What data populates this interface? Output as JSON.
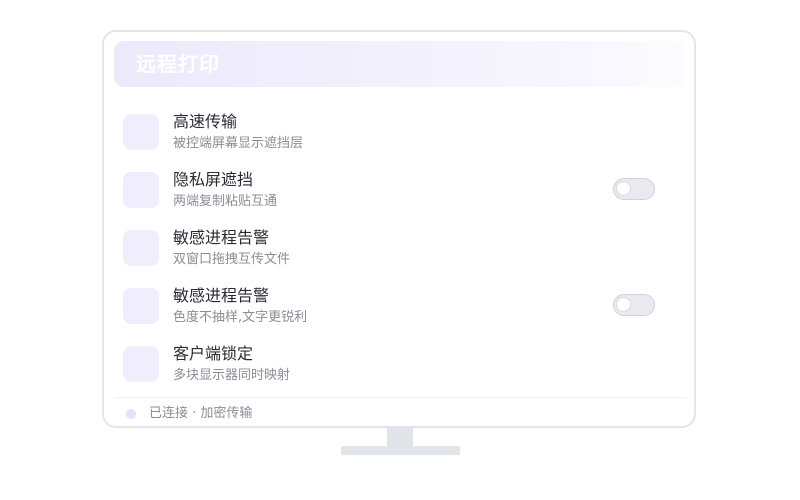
{
  "header": {
    "title": "远程打印"
  },
  "rows": [
    {
      "title": "高速传输",
      "subtitle": "被控端屏幕显示遮挡层",
      "has_toggle": false
    },
    {
      "title": "隐私屏遮挡",
      "subtitle": "两端复制粘贴互通",
      "has_toggle": true,
      "toggle_on": false
    },
    {
      "title": "敏感进程告警",
      "subtitle": "双窗口拖拽互传文件",
      "has_toggle": false
    },
    {
      "title": "敏感进程告警",
      "subtitle": "色度不抽样,文字更锐利",
      "has_toggle": true,
      "toggle_on": false
    },
    {
      "title": "客户端锁定",
      "subtitle": "多块显示器同时映射",
      "has_toggle": false
    }
  ],
  "status": {
    "text": "已连接 · 加密传输"
  },
  "colors": {
    "accent_light": "#f0edfc",
    "header_gradient_start": "#ece9fb",
    "toggle_off": "#e8eaef",
    "stand": "#e1e5ea"
  }
}
